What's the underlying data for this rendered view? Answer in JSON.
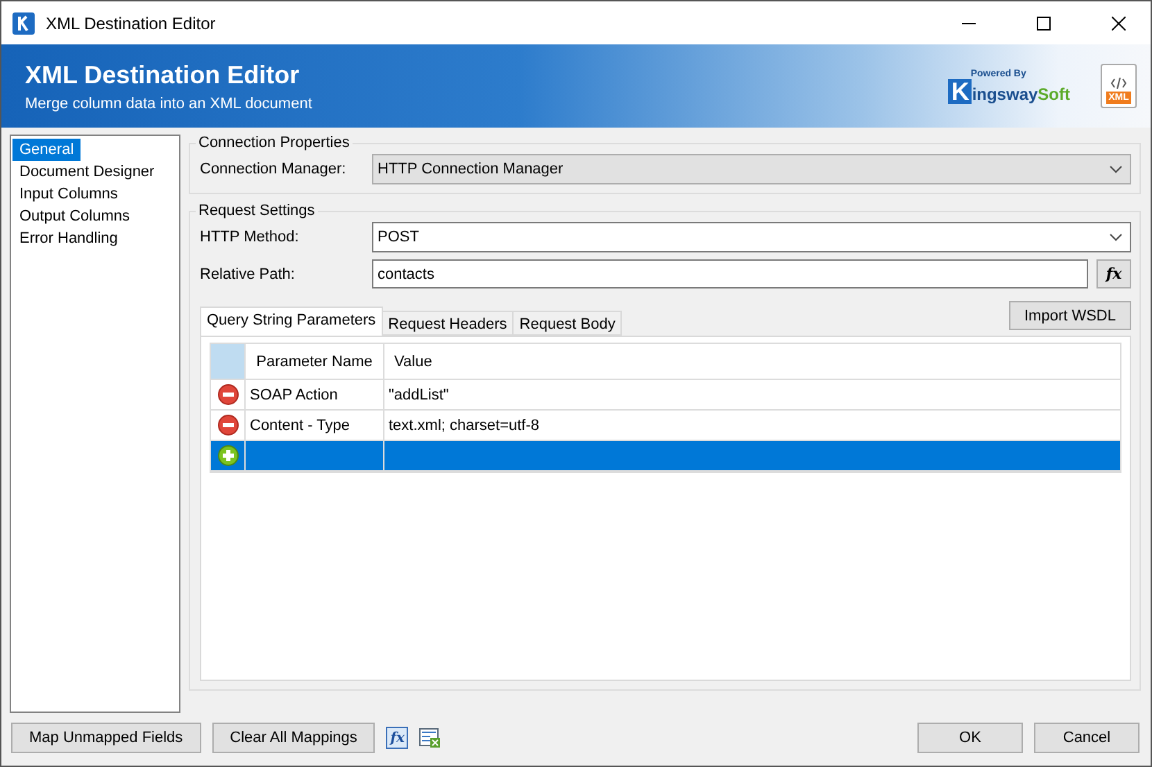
{
  "window": {
    "title": "XML Destination Editor"
  },
  "banner": {
    "title": "XML Destination Editor",
    "subtitle": "Merge column data into an XML document",
    "logo_small": "Powered By",
    "logo_k": "K",
    "logo_main": "ingsway",
    "logo_accent": "Soft",
    "file_badge": "XML"
  },
  "sidebar": {
    "items": [
      {
        "label": "General",
        "selected": true
      },
      {
        "label": "Document Designer",
        "selected": false
      },
      {
        "label": "Input Columns",
        "selected": false
      },
      {
        "label": "Output Columns",
        "selected": false
      },
      {
        "label": "Error Handling",
        "selected": false
      }
    ]
  },
  "connection": {
    "legend": "Connection Properties",
    "label": "Connection Manager:",
    "value": "HTTP Connection Manager"
  },
  "request": {
    "legend": "Request Settings",
    "method_label": "HTTP Method:",
    "method_value": "POST",
    "path_label": "Relative Path:",
    "path_value": "contacts",
    "fx": "fx",
    "import_button": "Import WSDL"
  },
  "tabs": [
    {
      "label": "Query String Parameters",
      "selected": true
    },
    {
      "label": "Request Headers",
      "selected": false
    },
    {
      "label": "Request Body",
      "selected": false
    }
  ],
  "table": {
    "columns": [
      "Parameter Name",
      "Value"
    ],
    "rows": [
      {
        "kind": "remove",
        "name": "SOAP Action",
        "value": "\"addList\"",
        "selected": false
      },
      {
        "kind": "remove",
        "name": "Content - Type",
        "value": "text.xml; charset=utf-8",
        "selected": false
      },
      {
        "kind": "add",
        "name": "",
        "value": "",
        "selected": true
      }
    ]
  },
  "footer": {
    "buttons": [
      "Map Unmapped Fields",
      "Clear All Mappings"
    ],
    "fx": "fx",
    "ok": "OK",
    "cancel": "Cancel"
  }
}
